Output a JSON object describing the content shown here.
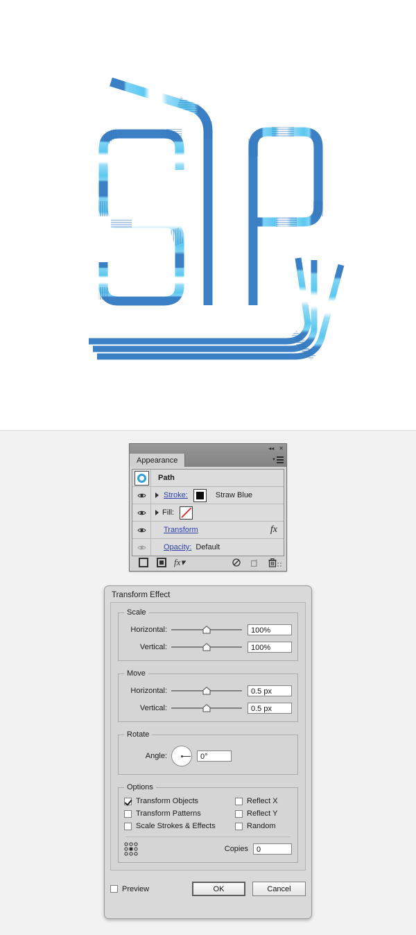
{
  "artwork": {
    "description": "Vector illustration of bendy drinking straws arranged to spell letterforms",
    "colors": {
      "straw_dark_blue": "#3b7fc4",
      "straw_light_blue": "#5bc8f0",
      "straw_pale": "#a9dff7",
      "straw_white": "#ffffff",
      "background": "#ffffff"
    }
  },
  "appearance_panel": {
    "titlebar": {
      "collapse_icon": "◂◂",
      "close_icon": "✕"
    },
    "tab": "Appearance",
    "menu_icon": "panel-menu-icon",
    "rows": [
      {
        "name": "Path",
        "type": "header",
        "thumb": "path-ring-thumb"
      },
      {
        "name": "Stroke:",
        "type": "stroke",
        "value": "Straw Blue",
        "eye": "visible",
        "disclosure": "collapsed"
      },
      {
        "name": "Fill:",
        "type": "fill",
        "value": "",
        "eye": "visible",
        "disclosure": "collapsed"
      },
      {
        "name": "Transform",
        "type": "effect",
        "fx": "fx",
        "eye": "visible"
      },
      {
        "name": "Opacity:",
        "type": "opacity",
        "value": "Default",
        "eye": "dimmed"
      }
    ],
    "footer_icons": [
      "add-new-stroke-icon",
      "add-new-fill-icon",
      "add-new-effect-icon",
      "clear-appearance-icon",
      "duplicate-item-icon",
      "delete-item-icon"
    ]
  },
  "transform_dialog": {
    "title": "Transform Effect",
    "scale": {
      "legend": "Scale",
      "horizontal_label": "Horizontal:",
      "horizontal_value": "100%",
      "vertical_label": "Vertical:",
      "vertical_value": "100%"
    },
    "move": {
      "legend": "Move",
      "horizontal_label": "Horizontal:",
      "horizontal_value": "0.5 px",
      "vertical_label": "Vertical:",
      "vertical_value": "0.5 px"
    },
    "rotate": {
      "legend": "Rotate",
      "angle_label": "Angle:",
      "angle_value": "0°"
    },
    "options": {
      "legend": "Options",
      "transform_objects": {
        "label": "Transform Objects",
        "checked": true
      },
      "transform_patterns": {
        "label": "Transform Patterns",
        "checked": false
      },
      "scale_strokes": {
        "label": "Scale Strokes & Effects",
        "checked": false
      },
      "reflect_x": {
        "label": "Reflect X",
        "checked": false
      },
      "reflect_y": {
        "label": "Reflect Y",
        "checked": false
      },
      "random": {
        "label": "Random",
        "checked": false
      },
      "copies_label": "Copies",
      "copies_value": "0",
      "reference_point": "center"
    },
    "preview": {
      "label": "Preview",
      "checked": false
    },
    "ok_label": "OK",
    "cancel_label": "Cancel"
  }
}
